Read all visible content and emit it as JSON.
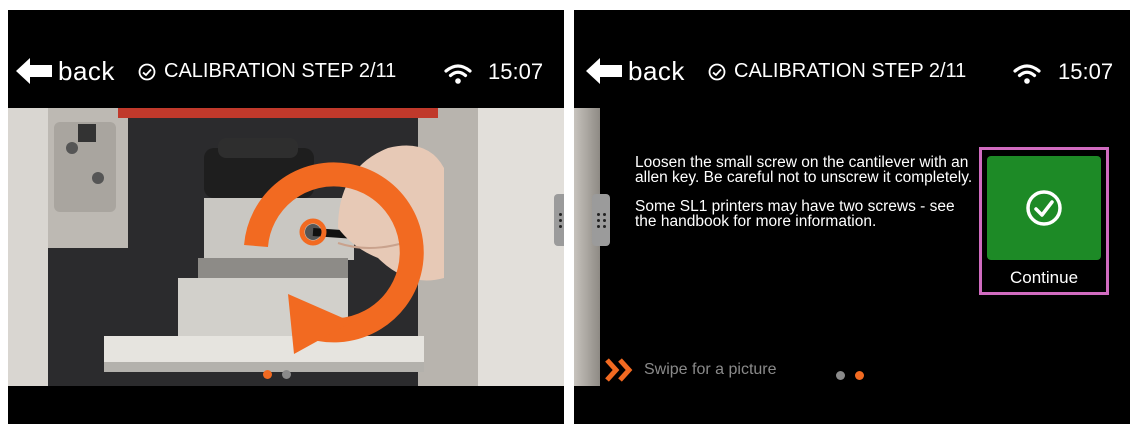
{
  "header": {
    "back_label": "back",
    "step_title": "CALIBRATION STEP 2/11",
    "time": "15:07"
  },
  "instructions": {
    "paragraph1": "Loosen the small screw on the cantilever with an allen key. Be careful not to unscrew it completely.",
    "paragraph2": "Some SL1 printers may have two screws - see the handbook for more information."
  },
  "continue_label": "Continue",
  "swipe_hint": "Swipe for a picture",
  "pager": {
    "total": 2,
    "left_active_index": 0,
    "right_active_index": 1
  },
  "colors": {
    "accent": "#f26a21",
    "continue_green": "#1d8a26",
    "focus_border": "#d06bc0"
  },
  "icons": [
    "back-arrow-icon",
    "check-circle-icon",
    "wifi-icon",
    "drag-handle-icon",
    "double-chevron-right-icon"
  ]
}
